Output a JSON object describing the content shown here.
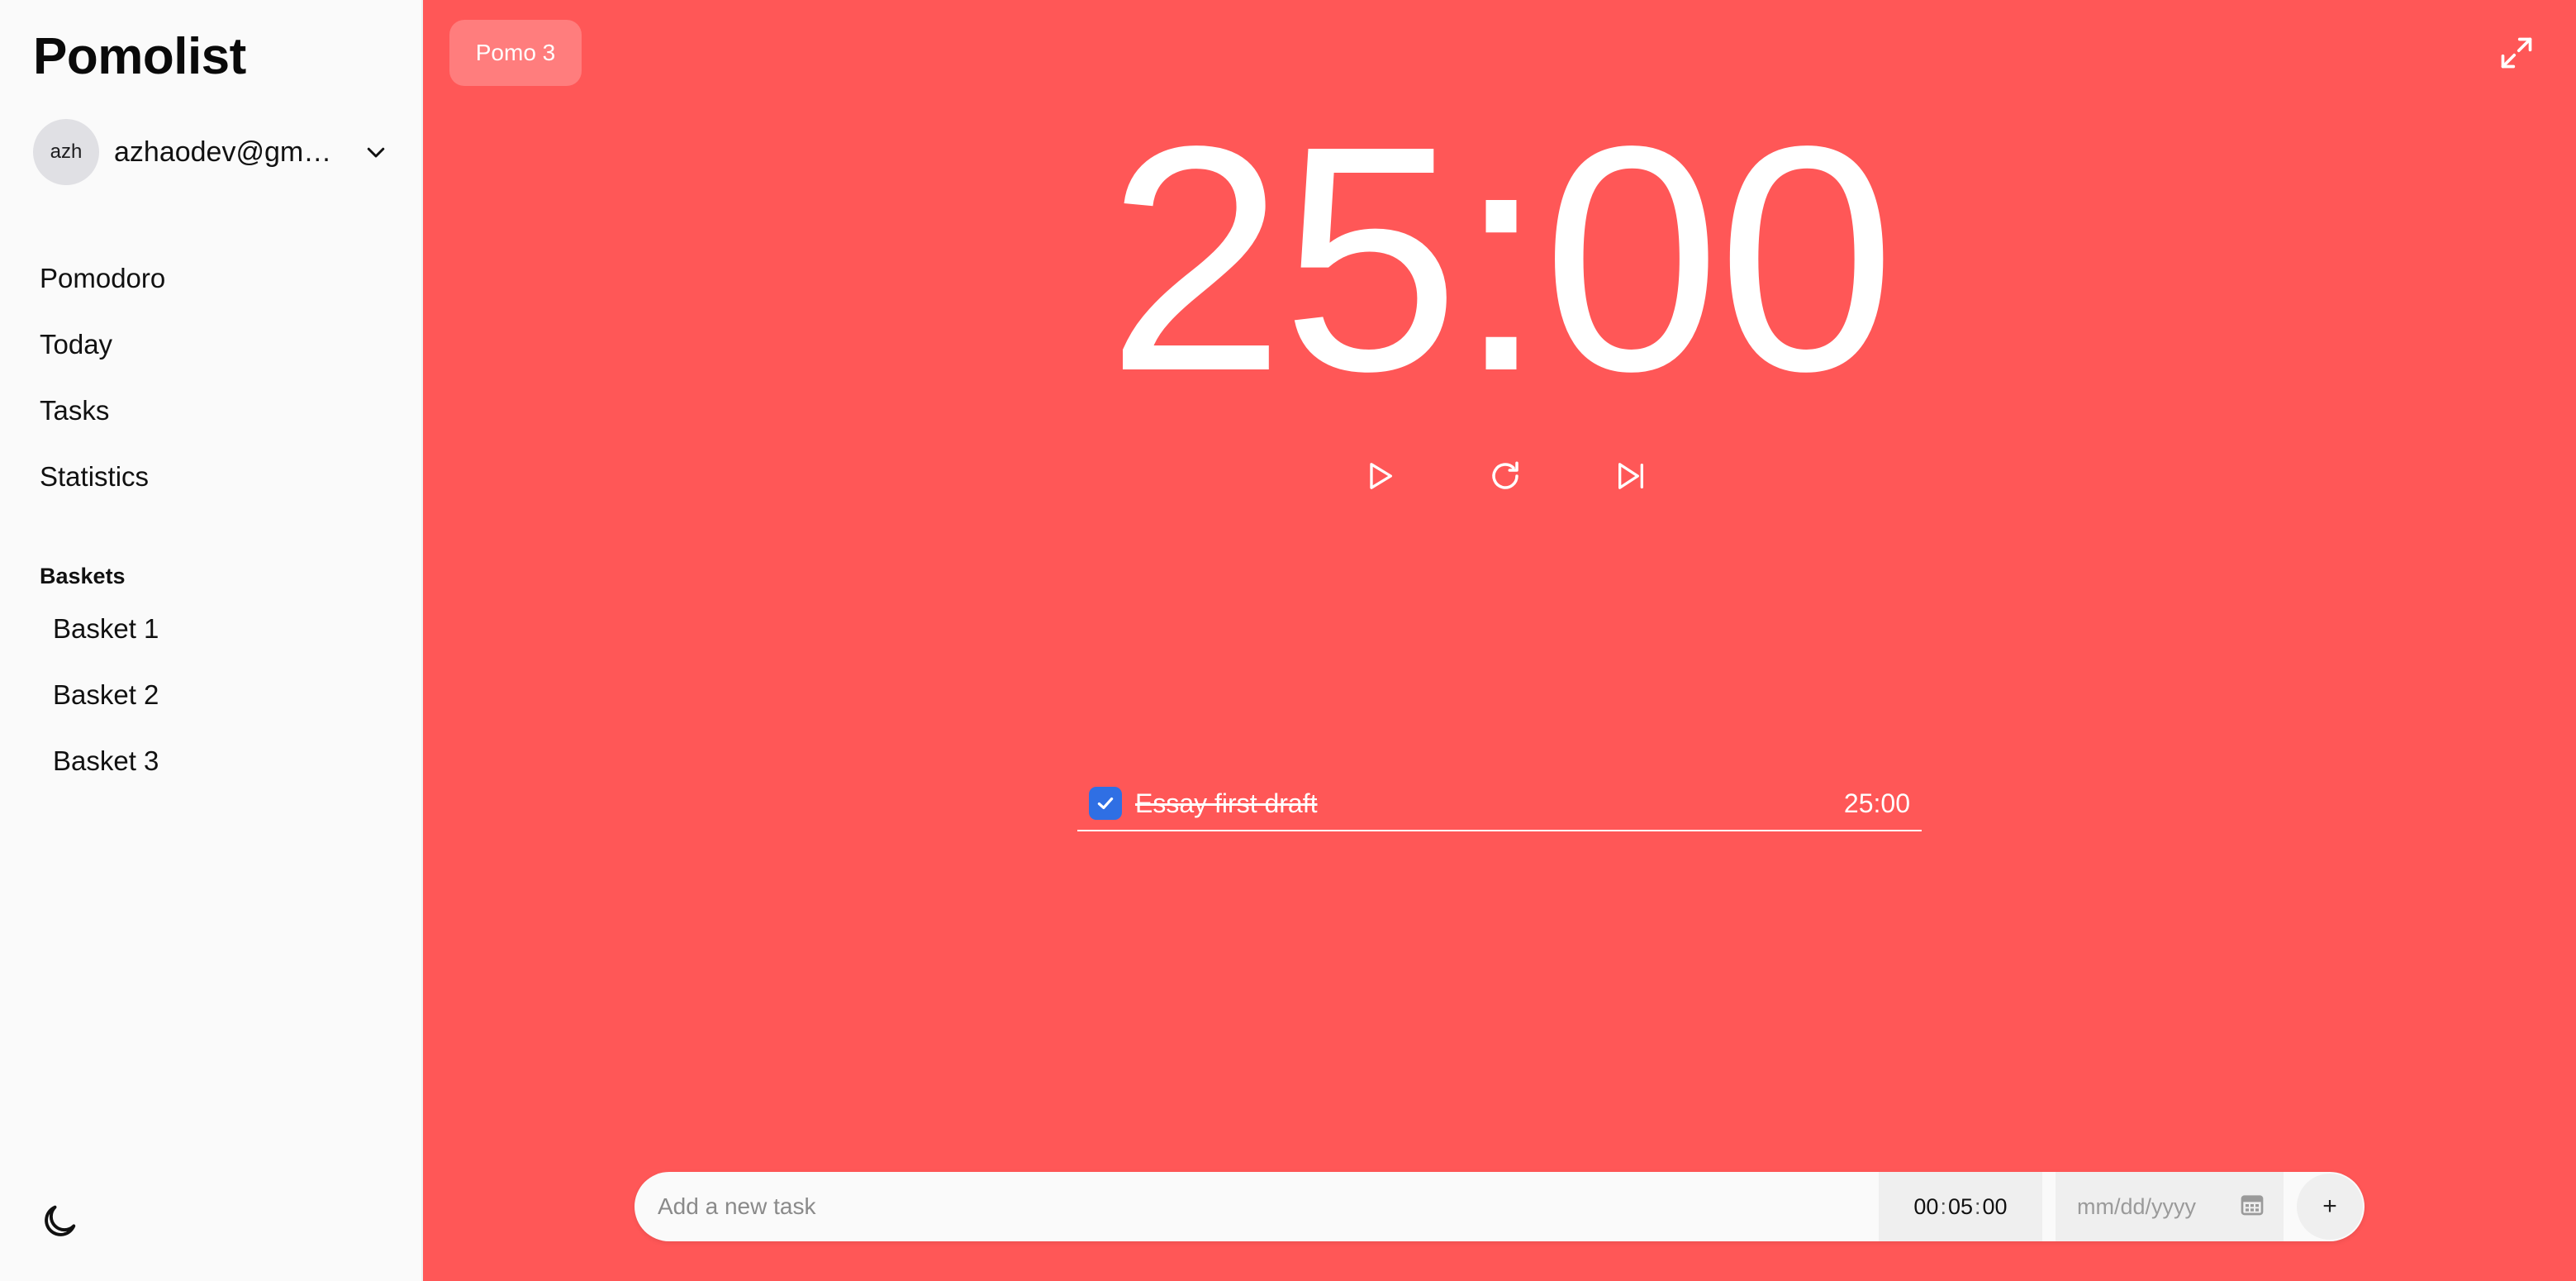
{
  "app": {
    "title": "Pomolist"
  },
  "account": {
    "avatar_initials": "azh",
    "email": "azhaodev@gmail..."
  },
  "nav": {
    "items": [
      {
        "label": "Pomodoro"
      },
      {
        "label": "Today"
      },
      {
        "label": "Tasks"
      },
      {
        "label": "Statistics"
      }
    ]
  },
  "baskets": {
    "heading": "Baskets",
    "items": [
      {
        "label": "Basket 1"
      },
      {
        "label": "Basket 2"
      },
      {
        "label": "Basket 3"
      }
    ]
  },
  "session": {
    "tab_label": "Pomo 3"
  },
  "timer": {
    "display": "25:00"
  },
  "tasks": [
    {
      "name": "Essay first draft",
      "time": "25:00",
      "completed": true
    }
  ],
  "add_task": {
    "placeholder": "Add a new task",
    "duration": {
      "hh": "00",
      "mm": "05",
      "ss": "00"
    },
    "date_placeholder": "mm/dd/yyyy",
    "add_label": "+"
  },
  "colors": {
    "main_bg": "#ff5757",
    "sidebar_bg": "#fafafa",
    "check_blue": "#2f6fe4"
  },
  "icons": {
    "chevron": "chevron-down-icon",
    "theme": "moon-icon",
    "fullscreen": "expand-icon",
    "play": "play-icon",
    "reset": "reset-icon",
    "skip": "skip-forward-icon",
    "calendar": "calendar-icon",
    "check": "check-icon"
  }
}
